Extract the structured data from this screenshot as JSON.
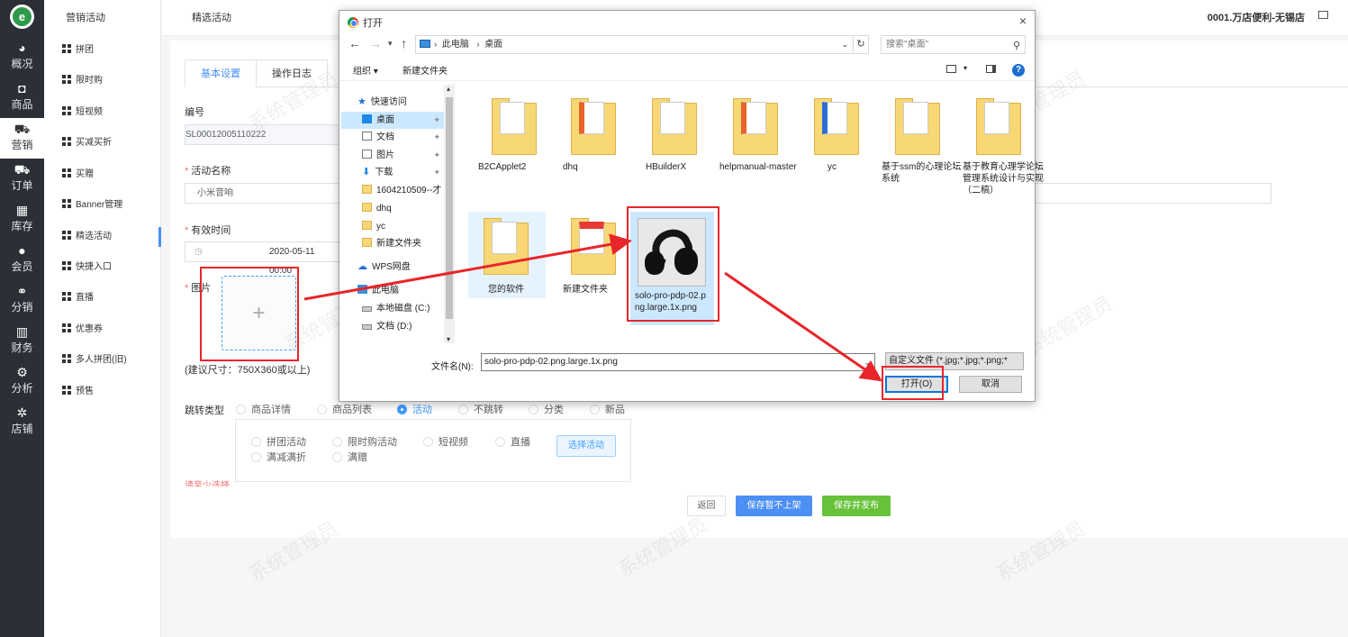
{
  "rail": {
    "logo": "e",
    "items": [
      {
        "label": "概况",
        "icon": "dashboard-icon"
      },
      {
        "label": "商品",
        "icon": "bag-icon"
      },
      {
        "label": "营销",
        "icon": "cart-icon"
      },
      {
        "label": "订单",
        "icon": "cart-icon"
      },
      {
        "label": "库存",
        "icon": "grid-icon"
      },
      {
        "label": "会员",
        "icon": "user-icon"
      },
      {
        "label": "分销",
        "icon": "share-icon"
      },
      {
        "label": "财务",
        "icon": "bar-chart-icon"
      },
      {
        "label": "分析",
        "icon": "analysis-icon"
      },
      {
        "label": "店铺",
        "icon": "gear-icon"
      }
    ],
    "active_index": 2
  },
  "menu": {
    "title": "营销活动",
    "items": [
      "拼团",
      "限时购",
      "短视频",
      "买减买折",
      "买赠",
      "Banner管理",
      "精选活动",
      "快捷入口",
      "直播",
      "优惠券",
      "多人拼团(旧)",
      "预售"
    ],
    "active_index": 6
  },
  "topbar": {
    "breadcrumb": "精选活动",
    "store": "0001.万店便利-无锡店"
  },
  "form": {
    "tabs": [
      "基本设置",
      "操作日志"
    ],
    "code_label": "编号",
    "code_value": "SL00012005110222",
    "name_label": "活动名称",
    "name_value": "小米音响",
    "time_label": "有效时间",
    "time_value": "2020-05-11 00:00",
    "image_label": "图片",
    "upload_plus": "+",
    "size_hint": "(建议尺寸：750X360或以上)",
    "jump_label": "跳转类型",
    "jump_options": [
      "商品详情",
      "商品列表",
      "活动",
      "不跳转",
      "分类",
      "新品"
    ],
    "jump_selected": "活动",
    "activity_options": [
      "拼团活动",
      "限时购活动",
      "短视频",
      "直播",
      "满减满折",
      "满赠"
    ],
    "select_activity": "选择活动",
    "warning": "请至少选择"
  },
  "buttons": {
    "back": "返回",
    "save_draft": "保存暂不上架",
    "save_publish": "保存并发布"
  },
  "watermark": "系统管理员",
  "dialog": {
    "title": "打开",
    "close": "×",
    "path": [
      "此电脑",
      "桌面"
    ],
    "search_placeholder": "搜索\"桌面\"",
    "organize": "组织 ▾",
    "new_folder": "新建文件夹",
    "help": "?",
    "tree": [
      {
        "label": "快速访问",
        "icon": "star-icon",
        "pin": false
      },
      {
        "label": "桌面",
        "icon": "desktop-icon",
        "pin": true
      },
      {
        "label": "文档",
        "icon": "document-icon",
        "pin": true
      },
      {
        "label": "图片",
        "icon": "picture-icon",
        "pin": true
      },
      {
        "label": "下载",
        "icon": "download-icon",
        "pin": true
      },
      {
        "label": "1604210509--才",
        "icon": "folder-icon",
        "pin": false
      },
      {
        "label": "dhq",
        "icon": "folder-icon",
        "pin": false
      },
      {
        "label": "yc",
        "icon": "folder-icon",
        "pin": false
      },
      {
        "label": "新建文件夹",
        "icon": "folder-icon",
        "pin": false
      },
      {
        "label": "WPS网盘",
        "icon": "cloud-icon",
        "pin": false
      },
      {
        "label": "此电脑",
        "icon": "computer-icon",
        "pin": false
      },
      {
        "label": "本地磁盘 (C:)",
        "icon": "disk-icon",
        "pin": false
      },
      {
        "label": "文档 (D:)",
        "icon": "disk-icon",
        "pin": false
      }
    ],
    "files": [
      "B2CApplet2",
      "dhq",
      "HBuilderX",
      "helpmanual-master",
      "yc",
      "基于ssm的心理论坛系统",
      "基于教育心理学论坛管理系统设计与实现（二稿）",
      "您的软件",
      "新建文件夹",
      "solo-pro-pdp-02.png.large.1x.png"
    ],
    "filename_label": "文件名(N):",
    "filename_value": "solo-pro-pdp-02.png.large.1x.png",
    "filetype": "自定义文件 (*.jpg;*.jpg;*.png;*",
    "open_button": "打开(O)",
    "cancel_button": "取消"
  },
  "colors": {
    "annotation_red": "#e8252a",
    "primary_blue": "#4c8ff5",
    "publish_green": "#67c23a"
  }
}
